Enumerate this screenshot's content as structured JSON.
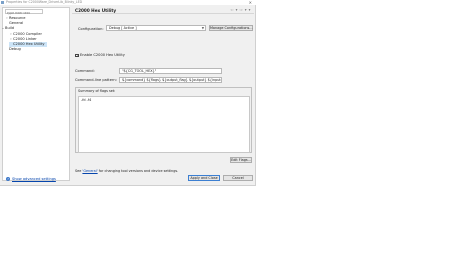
{
  "window": {
    "title": "Properties for C2000Ware_DriverLib_Blinky_LED",
    "close_glyph": "✕"
  },
  "nav": {
    "filter_placeholder": "type filter text",
    "items": [
      {
        "label": "Resource",
        "twisty": "›",
        "level": 1
      },
      {
        "label": "General",
        "twisty": "",
        "level": 1
      },
      {
        "label": "Build",
        "twisty": "⌄",
        "level": 0
      },
      {
        "label": "C2000 Compiler",
        "twisty": "›",
        "level": 2
      },
      {
        "label": "C2000 Linker",
        "twisty": "›",
        "level": 2
      },
      {
        "label": "C2000 Hex Utility",
        "twisty": "",
        "level": 2,
        "selected": true
      },
      {
        "label": "Debug",
        "twisty": "",
        "level": 0
      }
    ]
  },
  "page": {
    "title": "C2000 Hex Utility",
    "nav_arrows": "⇦ ▾ ⇨ ▾ ▾",
    "configuration_label": "Configuration:",
    "configuration_value": "Debug  [ Active ]",
    "manage_button": "Manage Configurations...",
    "enable_checkbox_checked": true,
    "enable_label": "Enable C2000 Hex Utility",
    "command_label": "Command:",
    "command_value": "\"${CG_TOOL_HEX}\"",
    "pattern_label": "Command-line pattern:",
    "pattern_value": "${command} ${flags} ${output_flag} ${output} ${inputs}",
    "summary_label": "Summary of flags set:",
    "summary_value": "-fd -f4",
    "edit_flags_button": "Edit Flags...",
    "footer_prefix": "See ",
    "footer_link": "'General'",
    "footer_suffix": " for changing tool versions and device settings."
  },
  "bottom": {
    "help_glyph": "?",
    "advanced_link": "Show advanced settings",
    "apply_button": "Apply and Close",
    "cancel_button": "Cancel"
  },
  "colors": {
    "selection": "#cce4f7",
    "link": "#0645ad",
    "default_button_border": "#3c7fd1"
  }
}
